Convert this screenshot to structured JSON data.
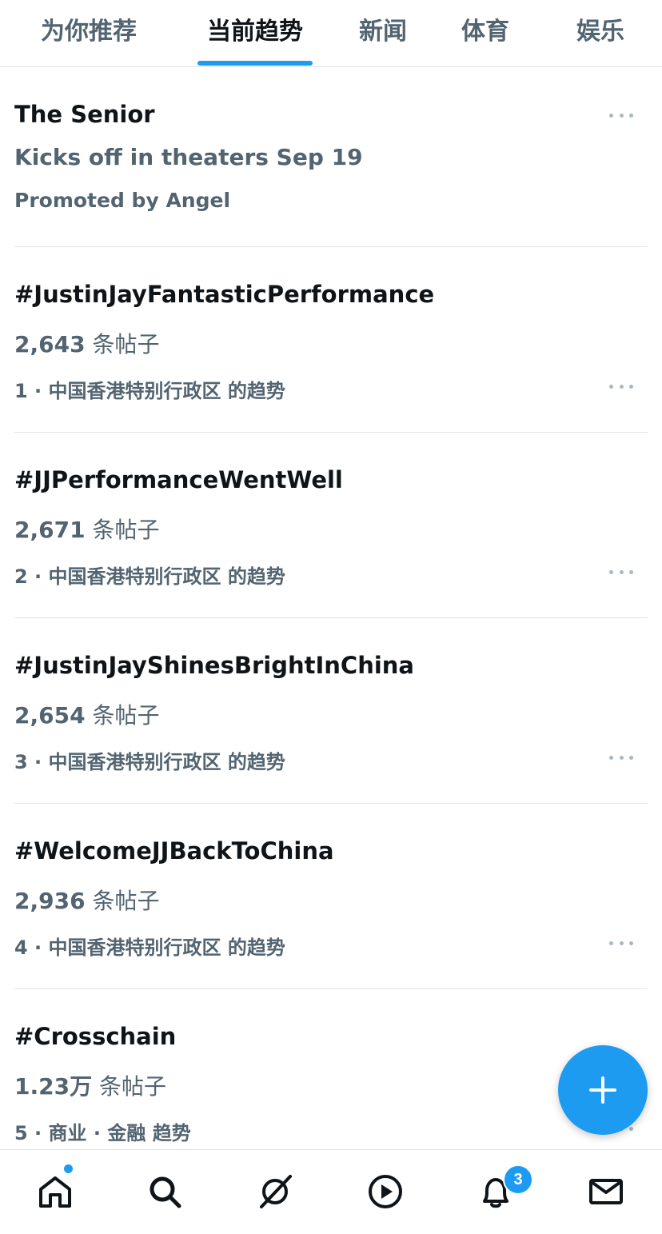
{
  "tabs": [
    {
      "label": "为你推荐"
    },
    {
      "label": "当前趋势"
    },
    {
      "label": "新闻"
    },
    {
      "label": "体育"
    },
    {
      "label": "娱乐"
    }
  ],
  "promoted": {
    "title": "The Senior",
    "subtitle": "Kicks off in theaters Sep 19",
    "promoter": "Promoted by Angel"
  },
  "trends": [
    {
      "title": "#JustinJayFantasticPerformance",
      "count": "2,643",
      "unit": " 条帖子",
      "meta": "1 · 中国香港特别行政区 的趋势"
    },
    {
      "title": "#JJPerformanceWentWell",
      "count": "2,671",
      "unit": " 条帖子",
      "meta": "2 · 中国香港特别行政区 的趋势"
    },
    {
      "title": "#JustinJayShinesBrightInChina",
      "count": "2,654",
      "unit": " 条帖子",
      "meta": "3 · 中国香港特别行政区 的趋势"
    },
    {
      "title": "#WelcomeJJBackToChina",
      "count": "2,936",
      "unit": " 条帖子",
      "meta": "4 · 中国香港特别行政区 的趋势"
    },
    {
      "title": "#Crosschain",
      "count": "1.23万",
      "unit": " 条帖子",
      "meta": "5 · 商业 · 金融 趋势"
    }
  ],
  "bottom_nav": {
    "items": [
      "home-icon",
      "search-icon",
      "grok-icon",
      "video-icon",
      "bell-icon",
      "mail-icon"
    ],
    "notification_count": "3"
  },
  "colors": {
    "accent": "#1d9bf0",
    "secondary_text": "#536471",
    "primary_text": "#0f1419"
  }
}
